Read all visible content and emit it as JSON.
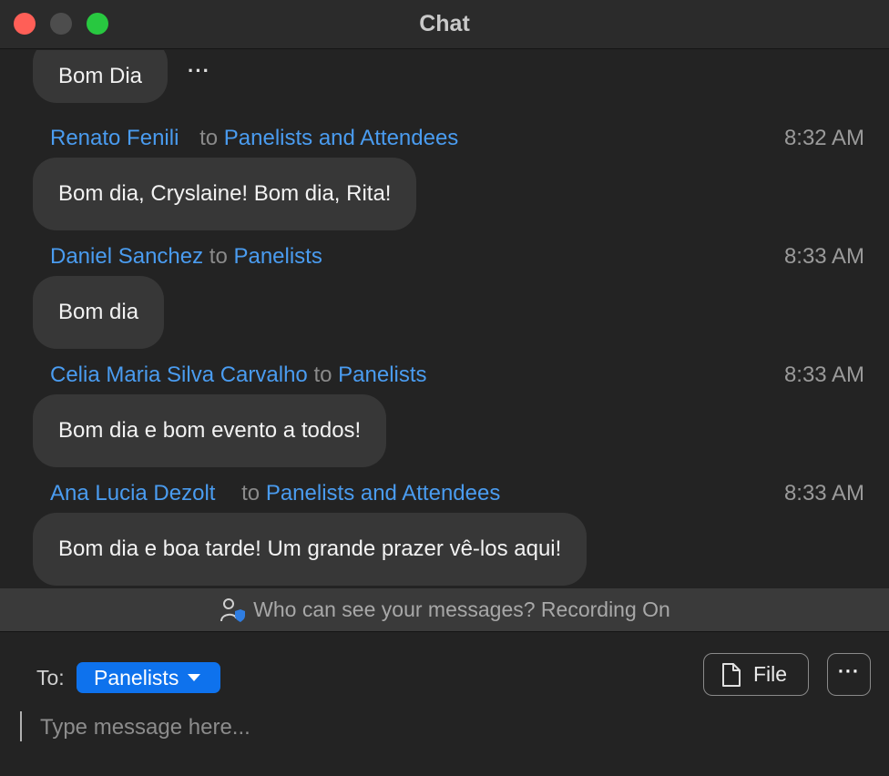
{
  "window": {
    "title": "Chat"
  },
  "messages": [
    {
      "text": "Bom Dia",
      "more": "···"
    },
    {
      "sender": "Renato Fenili",
      "to_word": "to",
      "recipient": "Panelists and Attendees",
      "time": "8:32 AM",
      "text": "Bom dia, Cryslaine! Bom dia, Rita!"
    },
    {
      "sender": "Daniel Sanchez",
      "to_word": "to",
      "recipient": "Panelists",
      "time": "8:33 AM",
      "text": "Bom dia"
    },
    {
      "sender": "Celia Maria Silva Carvalho",
      "to_word": "to",
      "recipient": "Panelists",
      "time": "8:33 AM",
      "text": "Bom dia e bom evento a todos!"
    },
    {
      "sender": "Ana Lucia Dezolt",
      "to_word": "to",
      "recipient": "Panelists and Attendees",
      "time": "8:33 AM",
      "text": "Bom dia e boa tarde! Um grande prazer vê-los aqui!"
    }
  ],
  "notice": {
    "text": "Who can see your messages? Recording On",
    "icon": "person-shield-icon"
  },
  "composer": {
    "to_label": "To:",
    "recipient": "Panelists",
    "file_label": "File",
    "more_label": "···",
    "placeholder": "Type message here..."
  },
  "colors": {
    "accent": "#0e72ed",
    "link": "#4a9cf0",
    "background": "#232323",
    "bubble": "#373737"
  }
}
